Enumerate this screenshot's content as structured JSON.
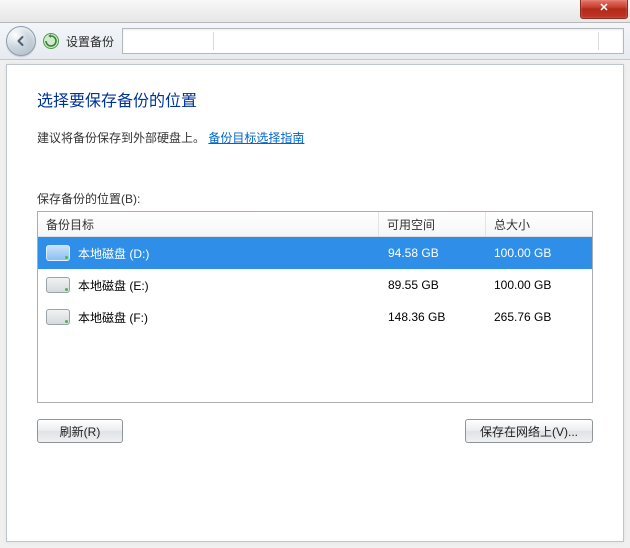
{
  "titlebar": {
    "close_symbol": "✕"
  },
  "navbar": {
    "title": "设置备份"
  },
  "heading": "选择要保存备份的位置",
  "advice_static": "建议将备份保存到外部硬盘上。",
  "advice_link": "备份目标选择指南",
  "list_label": "保存备份的位置(B):",
  "columns": {
    "target": "备份目标",
    "free": "可用空间",
    "total": "总大小"
  },
  "drives": [
    {
      "name": "本地磁盘 (D:)",
      "free": "94.58 GB",
      "total": "100.00 GB",
      "selected": true
    },
    {
      "name": "本地磁盘 (E:)",
      "free": "89.55 GB",
      "total": "100.00 GB",
      "selected": false
    },
    {
      "name": "本地磁盘 (F:)",
      "free": "148.36 GB",
      "total": "265.76 GB",
      "selected": false
    }
  ],
  "buttons": {
    "refresh": "刷新(R)",
    "save_network": "保存在网络上(V)..."
  }
}
